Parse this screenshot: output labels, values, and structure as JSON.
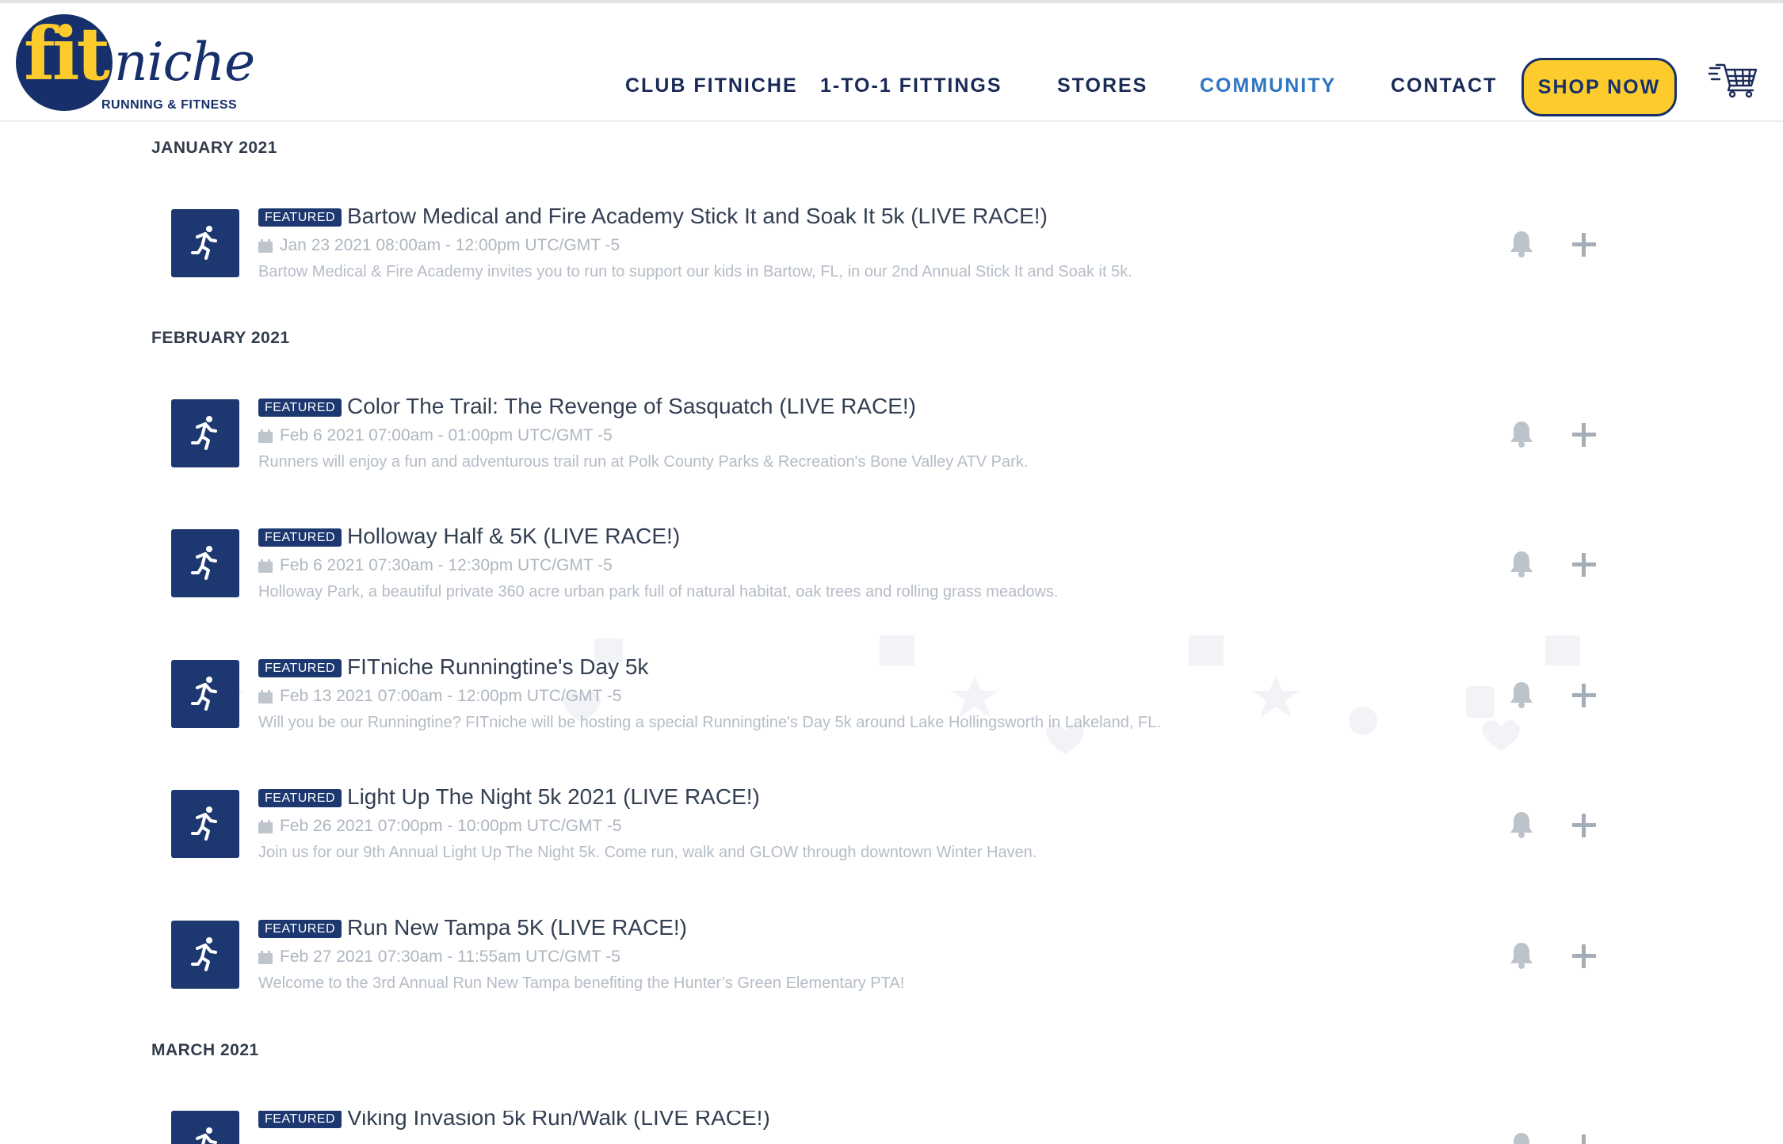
{
  "brand": {
    "logo_fit": "fit",
    "logo_niche": "niche",
    "logo_tagline": "RUNNING & FITNESS",
    "primary_color": "#1d3870",
    "accent_color": "#fdcc2c",
    "active_nav_color": "#2f75c4"
  },
  "nav": {
    "items": [
      {
        "label": "CLUB FITNICHE",
        "active": false
      },
      {
        "label": "1-TO-1 FITTINGS",
        "active": false
      },
      {
        "label": "STORES",
        "active": false
      },
      {
        "label": "COMMUNITY",
        "active": true
      },
      {
        "label": "CONTACT",
        "active": false
      }
    ],
    "shop_label": "SHOP NOW",
    "cart_icon": "shopping-cart-icon"
  },
  "calendar": {
    "months": [
      {
        "label": "JANUARY 2021",
        "events": [
          {
            "badge": "FEATURED",
            "title": "Bartow Medical and Fire Academy Stick It and Soak It 5k (LIVE RACE!)",
            "date": "Jan 23 2021 08:00am - 12:00pm UTC/GMT -5",
            "description": "Bartow Medical & Fire Academy invites you to run to support our kids in Bartow, FL, in our 2nd Annual Stick It and Soak it 5k."
          }
        ]
      },
      {
        "label": "FEBRUARY 2021",
        "events": [
          {
            "badge": "FEATURED",
            "title": "Color The Trail: The Revenge of Sasquatch (LIVE RACE!)",
            "date": "Feb 6 2021 07:00am - 01:00pm UTC/GMT -5",
            "description": "Runners will enjoy a fun and adventurous trail run at Polk County Parks & Recreation's Bone Valley ATV Park."
          },
          {
            "badge": "FEATURED",
            "title": "Holloway Half & 5K (LIVE RACE!)",
            "date": "Feb 6 2021 07:30am - 12:30pm UTC/GMT -5",
            "description": "Holloway Park, a beautiful private 360 acre urban park full of natural habitat, oak trees and rolling grass meadows."
          },
          {
            "badge": "FEATURED",
            "title": "FITniche Runningtine's Day 5k",
            "date": "Feb 13 2021 07:00am - 12:00pm UTC/GMT -5",
            "description": "Will you be our Runningtine? FITniche will be hosting a special Runningtine's Day 5k around Lake Hollingsworth in Lakeland, FL."
          },
          {
            "badge": "FEATURED",
            "title": "Light Up The Night 5k 2021 (LIVE RACE!)",
            "date": "Feb 26 2021 07:00pm - 10:00pm UTC/GMT -5",
            "description": "Join us for our 9th Annual Light Up The Night 5k. Come run, walk and GLOW through downtown Winter Haven."
          },
          {
            "badge": "FEATURED",
            "title": "Run New Tampa 5K (LIVE RACE!)",
            "date": "Feb 27 2021 07:30am - 11:55am UTC/GMT -5",
            "description": "Welcome to the 3rd Annual Run New Tampa benefiting the Hunter’s Green Elementary PTA!"
          }
        ]
      },
      {
        "label": "MARCH 2021",
        "events": [
          {
            "badge": "FEATURED",
            "title": "Viking Invasion 5k Run/Walk (LIVE RACE!)",
            "date": "",
            "description": ""
          }
        ]
      }
    ]
  }
}
